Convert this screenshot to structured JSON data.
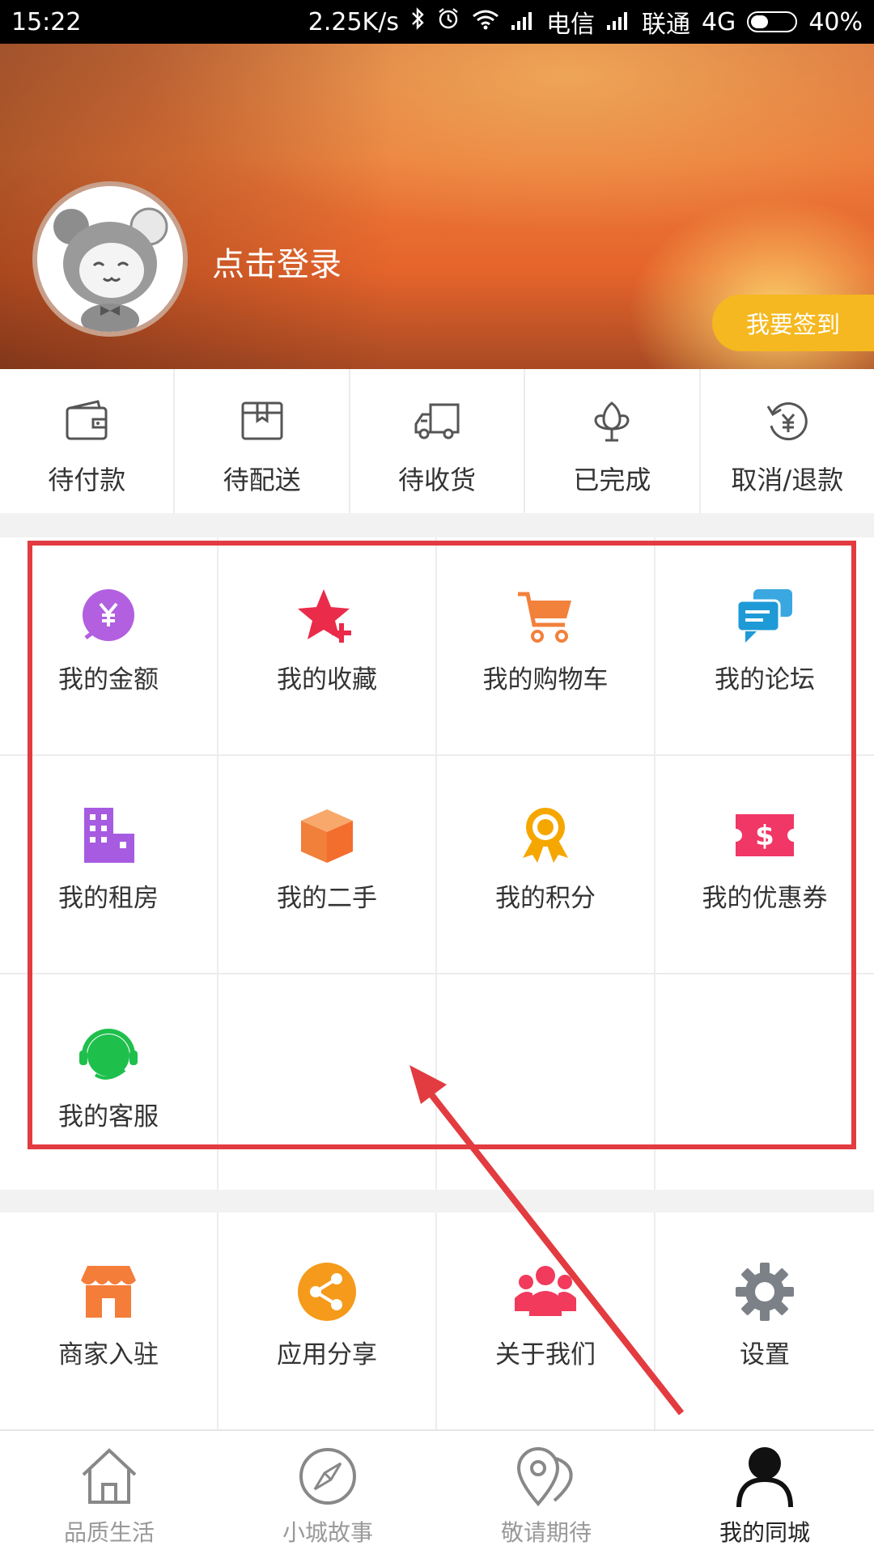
{
  "status_bar": {
    "time": "15:22",
    "network_speed": "2.25K/s",
    "carrier1": "电信",
    "carrier2": "联通",
    "network_type": "4G",
    "battery": "40%",
    "battery_level": 0.4
  },
  "header": {
    "login_text": "点击登录",
    "checkin_button": "我要签到"
  },
  "orders": [
    {
      "label": "待付款",
      "icon": "wallet-icon"
    },
    {
      "label": "待配送",
      "icon": "package-icon"
    },
    {
      "label": "待收货",
      "icon": "truck-icon"
    },
    {
      "label": "已完成",
      "icon": "flower-icon"
    },
    {
      "label": "取消/退款",
      "icon": "refund-icon"
    }
  ],
  "my_menu": [
    {
      "label": "我的金额",
      "icon": "yen-coin-icon"
    },
    {
      "label": "我的收藏",
      "icon": "star-plus-icon"
    },
    {
      "label": "我的购物车",
      "icon": "shopping-cart-icon"
    },
    {
      "label": "我的论坛",
      "icon": "chat-bubbles-icon"
    },
    {
      "label": "我的租房",
      "icon": "building-icon"
    },
    {
      "label": "我的二手",
      "icon": "box-icon"
    },
    {
      "label": "我的积分",
      "icon": "medal-icon"
    },
    {
      "label": "我的优惠券",
      "icon": "coupon-icon"
    },
    {
      "label": "我的客服",
      "icon": "headset-icon"
    }
  ],
  "more_menu": [
    {
      "label": "商家入驻",
      "icon": "shop-icon"
    },
    {
      "label": "应用分享",
      "icon": "share-icon"
    },
    {
      "label": "关于我们",
      "icon": "people-icon"
    },
    {
      "label": "设置",
      "icon": "gear-icon"
    }
  ],
  "tabs": [
    {
      "label": "品质生活",
      "icon": "home-icon"
    },
    {
      "label": "小城故事",
      "icon": "compass-icon"
    },
    {
      "label": "敬请期待",
      "icon": "map-pin-icon"
    },
    {
      "label": "我的同城",
      "icon": "user-icon",
      "active": true
    }
  ],
  "colors": {
    "highlight": "#e23b40",
    "checkin": "#f5b820",
    "header_orange": "#ec7a3a"
  }
}
